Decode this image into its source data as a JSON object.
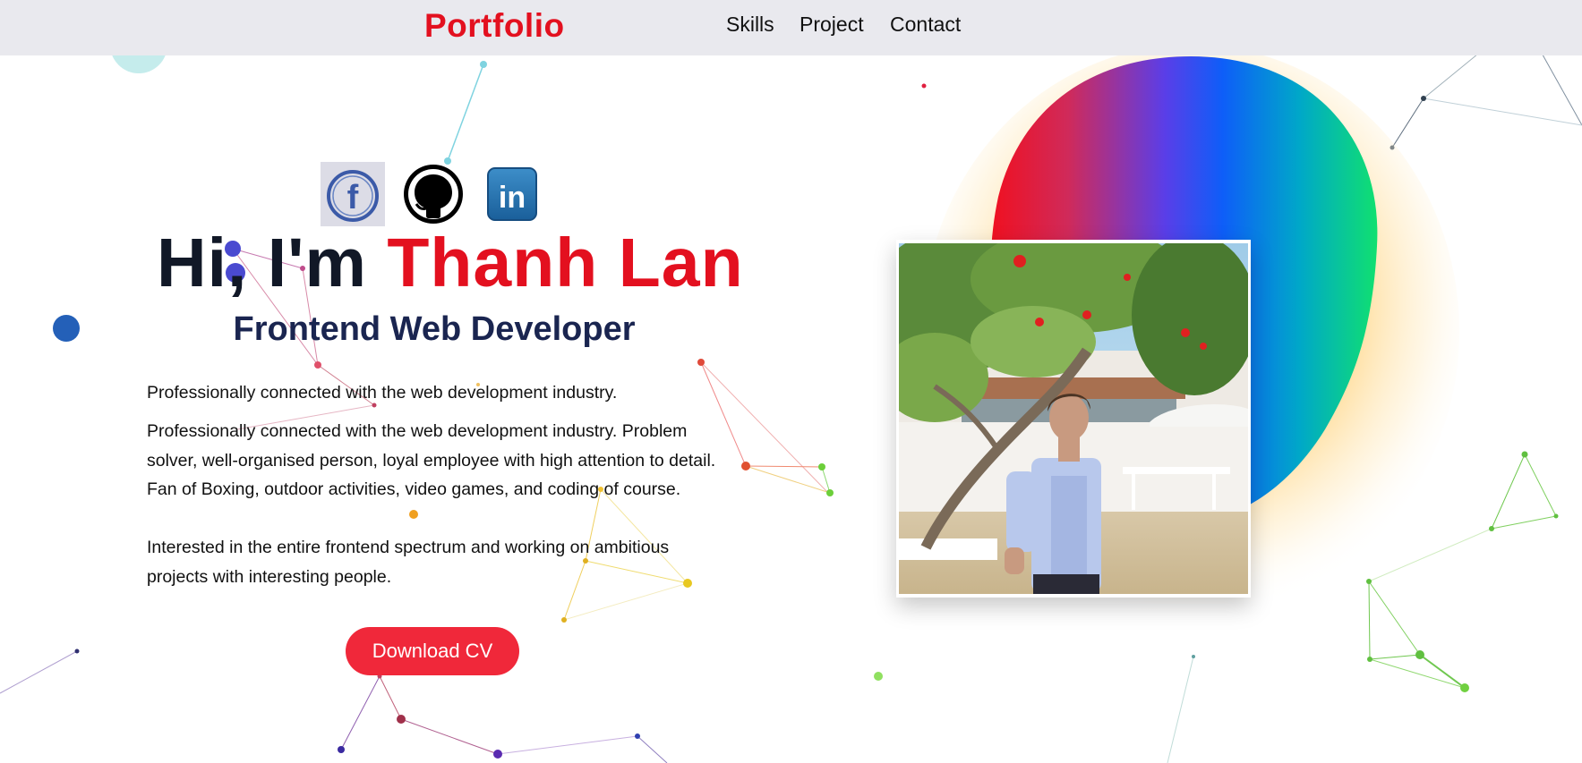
{
  "nav": {
    "logo": "Portfolio",
    "links": [
      {
        "label": "Skills"
      },
      {
        "label": "Project"
      },
      {
        "label": "Contact"
      }
    ]
  },
  "social": [
    {
      "name": "facebook-icon",
      "glyph": "f"
    },
    {
      "name": "github-icon"
    },
    {
      "name": "linkedin-icon",
      "glyph": "in"
    }
  ],
  "hero": {
    "greeting_prefix": "Hi, I'm ",
    "name": "Thanh Lan",
    "role": "Frontend Web Developer",
    "paragraph_1": "Professionally connected with the web development industry.",
    "paragraph_2": "Professionally connected with the web development industry. Problem solver, well-organised person, loyal employee with high attention to detail. Fan of Boxing, outdoor activities, video games, and coding of course.",
    "paragraph_3": "Interested in the entire frontend spectrum and working on ambitious projects with interesting people.",
    "cv_button": "Download CV"
  },
  "colors": {
    "accent": "#e3101f",
    "button": "#f0283a",
    "navbar_bg": "#e9e9ee",
    "role_text": "#1a2550"
  }
}
